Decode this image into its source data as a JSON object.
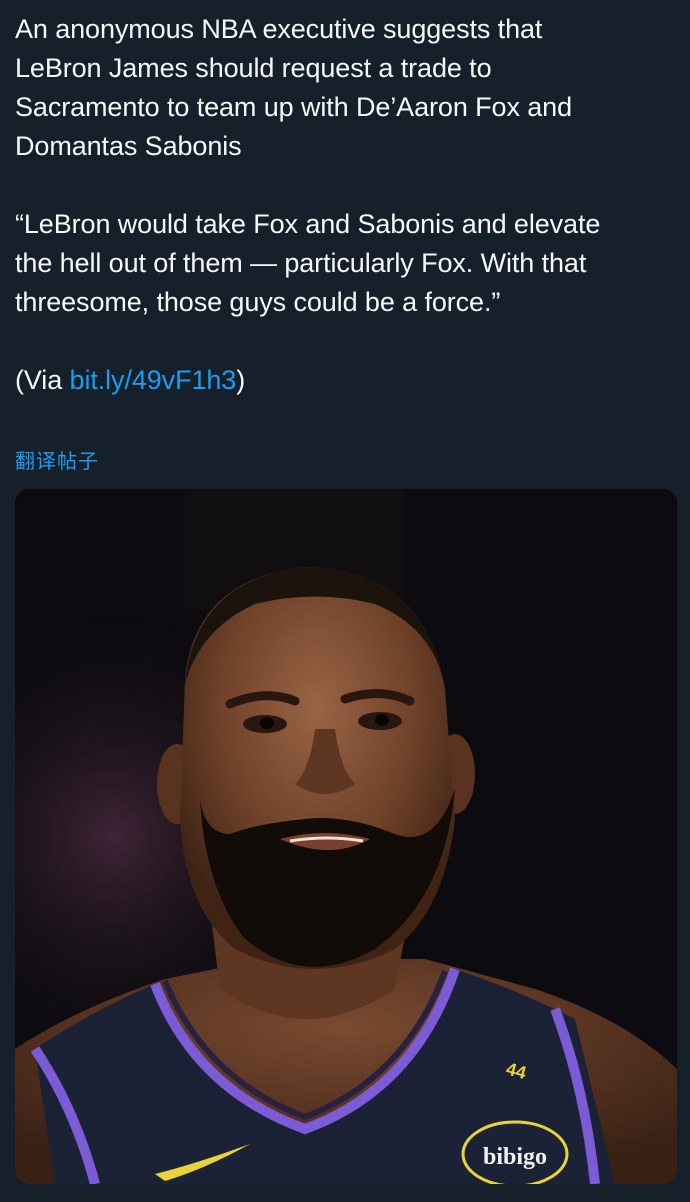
{
  "post": {
    "headline_line1": "An anonymous NBA executive suggests that",
    "headline_line2": "LeBron James should request a trade to",
    "headline_line3": "Sacramento to team up with De’Aaron Fox and",
    "headline_line4": "Domantas Sabonis",
    "quote_line1": "“LeBron would take Fox and Sabonis and elevate",
    "quote_line2": "the hell out of them — particularly Fox. With that",
    "quote_line3": "threesome, those guys could be a force.”",
    "via_prefix": "(Via ",
    "via_link": "bit.ly/49vF1h3",
    "via_suffix": ")",
    "translate_label": "翻译帖子"
  },
  "media": {
    "description_alt": "LeBron James in a dark purple Lakers jersey",
    "jersey_number": "44",
    "sponsor_patch": "bibigo"
  },
  "colors": {
    "background": "#15202b",
    "text": "#f7f9f9",
    "link": "#1d9bf0",
    "jersey": "#1c2236",
    "jersey_trim": "#7b5bd6"
  }
}
